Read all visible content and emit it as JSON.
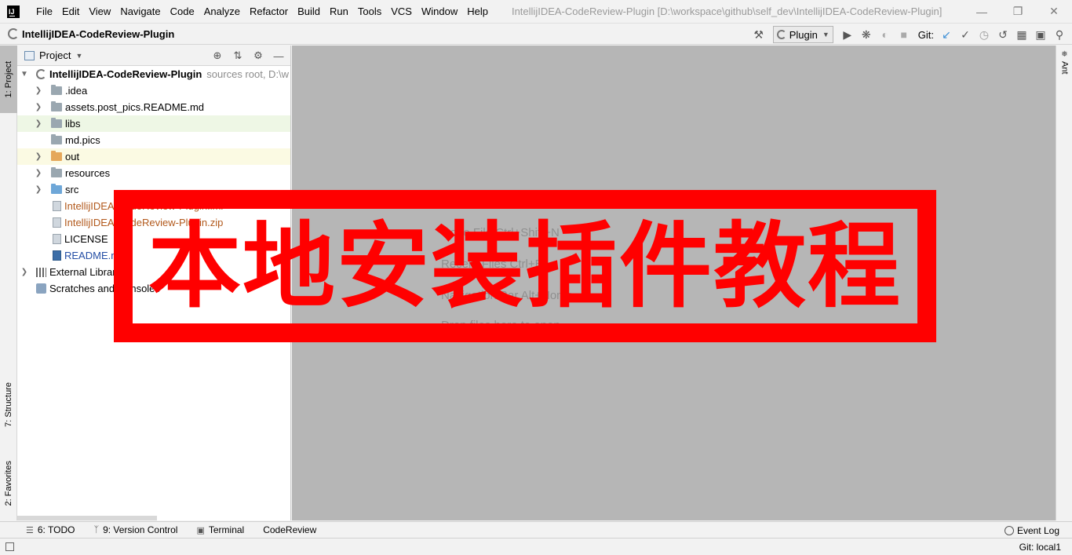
{
  "menubar": {
    "logo": "IJ",
    "items": [
      "File",
      "Edit",
      "View",
      "Navigate",
      "Code",
      "Analyze",
      "Refactor",
      "Build",
      "Run",
      "Tools",
      "VCS",
      "Window",
      "Help"
    ],
    "window_title": "IntellijIDEA-CodeReview-Plugin [D:\\workspace\\github\\self_dev\\IntellijIDEA-CodeReview-Plugin]"
  },
  "navbar": {
    "breadcrumb": "IntellijIDEA-CodeReview-Plugin",
    "run_config": "Plugin",
    "git_label": "Git:"
  },
  "left_stripe": {
    "project": "1: Project",
    "structure": "7: Structure",
    "favorites": "2: Favorites"
  },
  "right_stripe": {
    "ant": "Ant"
  },
  "project_panel": {
    "title": "Project",
    "tree": [
      {
        "label": "IntellijIDEA-CodeReview-Plugin",
        "hint": "sources root,  D:\\w"
      },
      {
        "label": ".idea"
      },
      {
        "label": "assets.post_pics.README.md"
      },
      {
        "label": "libs"
      },
      {
        "label": "md.pics"
      },
      {
        "label": "out"
      },
      {
        "label": "resources"
      },
      {
        "label": "src"
      },
      {
        "label": "IntellijIDEA-CodeReview-Plugin.iml"
      },
      {
        "label": "IntellijIDEA-CodeReview-Plugin.zip"
      },
      {
        "label": "LICENSE"
      },
      {
        "label": "README.md"
      },
      {
        "label": "External Libraries"
      },
      {
        "label": "Scratches and Consoles"
      }
    ]
  },
  "editor": {
    "ghost_lines": [
      "Go to File Ctrl+Shift+N",
      "Recent Files Ctrl+E",
      "Navigation Bar Alt+Home",
      "Drop files here to open"
    ]
  },
  "bottom_tools": {
    "todo": "6: TODO",
    "version_control": "9: Version Control",
    "terminal": "Terminal",
    "codereview": "CodeReview",
    "event_log": "Event Log"
  },
  "statusbar": {
    "git_branch": "Git: local1"
  },
  "banner": {
    "text": "本地安装插件教程",
    "color": "#ff0000"
  },
  "colors": {
    "editor_bg": "#b6b6b6",
    "libs_row_bg": "#eef7e5",
    "out_row_bg": "#fbfae3",
    "excluded_text": "#b2591c",
    "link_blue": "#254fa5"
  }
}
